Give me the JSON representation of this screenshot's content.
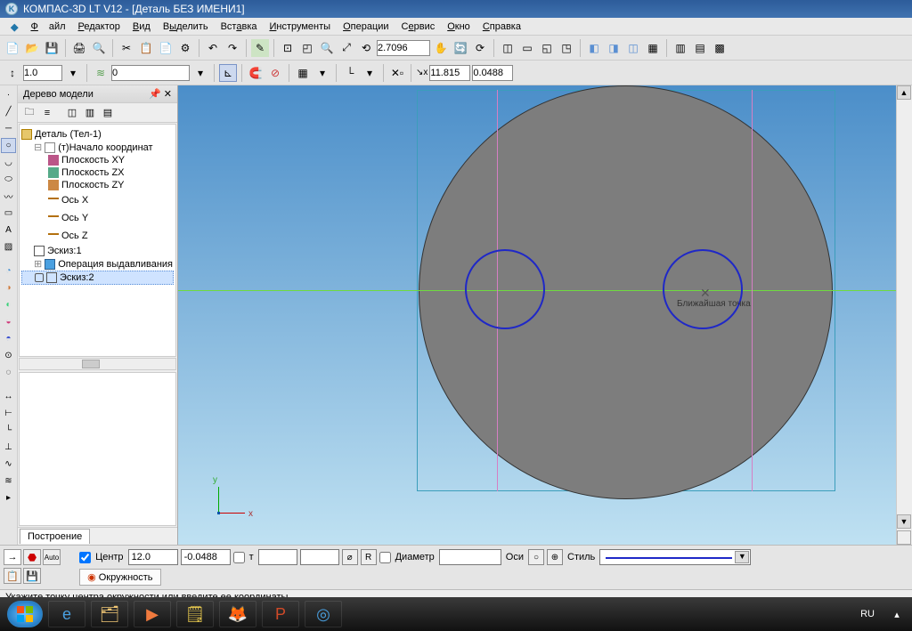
{
  "title": "КОМПАС-3D LT V12 - [Деталь БЕЗ ИМЕНИ1]",
  "menu": [
    "Файл",
    "Редактор",
    "Вид",
    "Выделить",
    "Вставка",
    "Инструменты",
    "Операции",
    "Сервис",
    "Окно",
    "Справка"
  ],
  "toolbar1_combo_scale": "2.7096",
  "toolbar2_spin": "1.0",
  "toolbar2_offset": "0",
  "toolbar2_x": "11.815",
  "toolbar2_y": "0.0488",
  "panel": {
    "title": "Дерево модели",
    "tree": {
      "root": "Деталь (Тел-1)",
      "origin": "(т)Начало координат",
      "planeXY": "Плоскость XY",
      "planeZX": "Плоскость ZX",
      "planeZY": "Плоскость ZY",
      "axisX": "Ось X",
      "axisY": "Ось Y",
      "axisZ": "Ось Z",
      "sketch1": "Эскиз:1",
      "extrude": "Операция выдавливания",
      "sketch2": "Эскиз:2"
    },
    "tab": "Построение"
  },
  "canvas": {
    "tooltip": "Ближайшая точка",
    "axis_x": "x",
    "axis_y": "y"
  },
  "props": {
    "center_lbl": "Центр",
    "center_x": "12.0",
    "center_y": "-0.0488",
    "t_lbl": "т",
    "diameter_lbl": "Диаметр",
    "diameter_val": "",
    "axes_lbl": "Оси",
    "style_lbl": "Стиль",
    "tab": "Окружность",
    "blank1": "",
    "blank2": ""
  },
  "status": "Укажите точку центра окружности или введите ее координаты",
  "taskbar": {
    "lang": "RU"
  }
}
